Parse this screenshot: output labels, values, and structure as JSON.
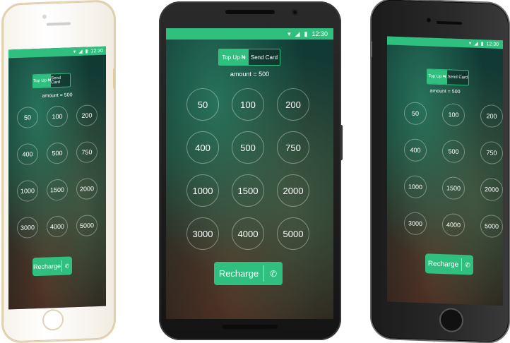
{
  "app": {
    "status_time": "12:30",
    "status_icons": [
      "wifi-icon",
      "signal-icon",
      "battery-icon"
    ],
    "tabs": [
      {
        "label": "Top Up ₦",
        "active": true
      },
      {
        "label": "Send Card",
        "active": false
      }
    ],
    "amount_label": "amount = 500",
    "amounts": [
      "50",
      "100",
      "200",
      "400",
      "500",
      "750",
      "1000",
      "1500",
      "2000",
      "3000",
      "4000",
      "5000"
    ],
    "recharge_label": "Recharge",
    "phone_icon": "phone-icon",
    "accent_color": "#2fbf7e"
  }
}
